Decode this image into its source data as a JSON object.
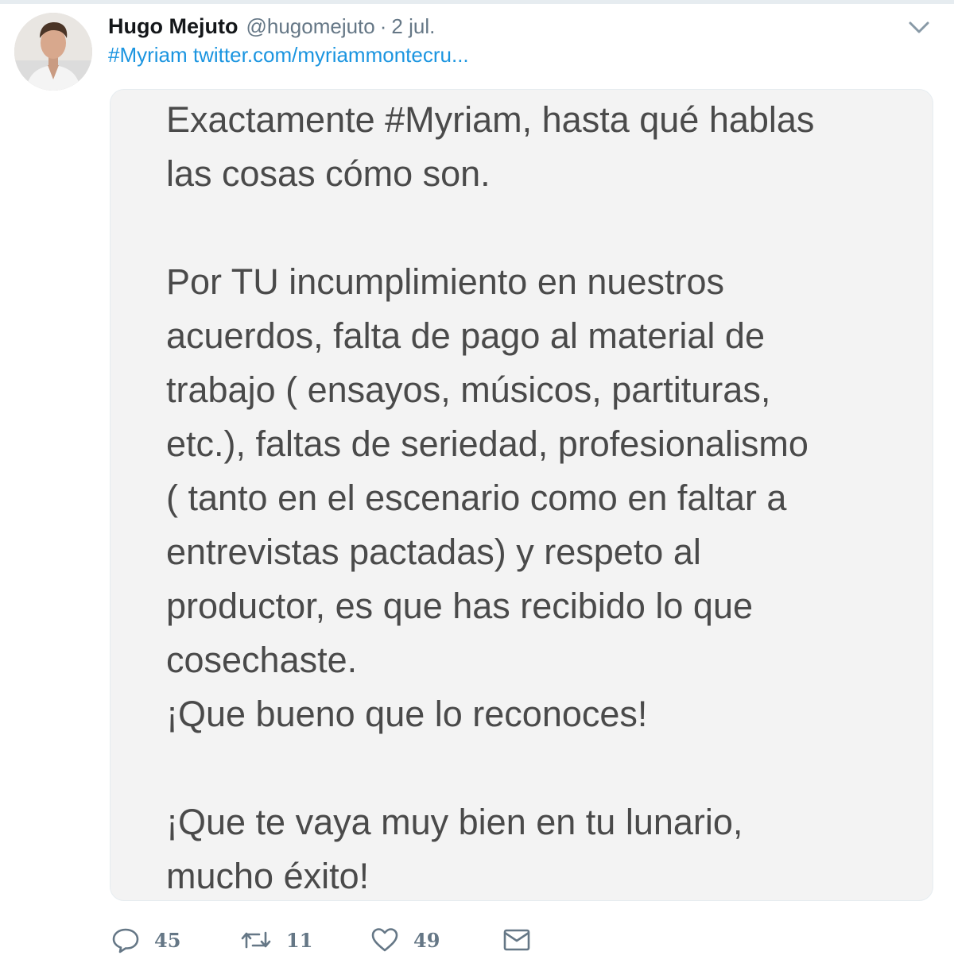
{
  "tweet": {
    "author_name": "Hugo Mejuto",
    "handle": "@hugomejuto",
    "separator": "·",
    "date": "2 jul.",
    "hashtag_link": "#Myriam",
    "url_link": "twitter.com/myriammontecru...",
    "image_text_lines": [
      "Exactamente #Myriam, hasta qué hablas",
      "las cosas cómo son.",
      "",
      "Por TU incumplimiento en nuestros",
      "acuerdos, falta de pago al material de",
      "trabajo ( ensayos, músicos, partituras,",
      "etc.), faltas de seriedad, profesionalismo",
      "( tanto en el escenario como en faltar a",
      "entrevistas pactadas) y respeto al",
      "productor, es que has recibido lo que",
      "cosechaste.",
      "¡Que bueno que lo reconoces!",
      "",
      "¡Que te vaya muy bien en tu  lunario,",
      "mucho éxito!"
    ],
    "actions": {
      "replies": "45",
      "retweets": "11",
      "likes": "49"
    },
    "icons": {
      "caret": "chevron-down-icon",
      "reply": "reply-icon",
      "retweet": "retweet-icon",
      "like": "heart-icon",
      "dm": "envelope-icon"
    },
    "colors": {
      "link": "#1b95e0",
      "secondary": "#657786",
      "name": "#14171a",
      "card_bg": "#f3f3f3",
      "card_text": "#4a4a4a"
    }
  }
}
